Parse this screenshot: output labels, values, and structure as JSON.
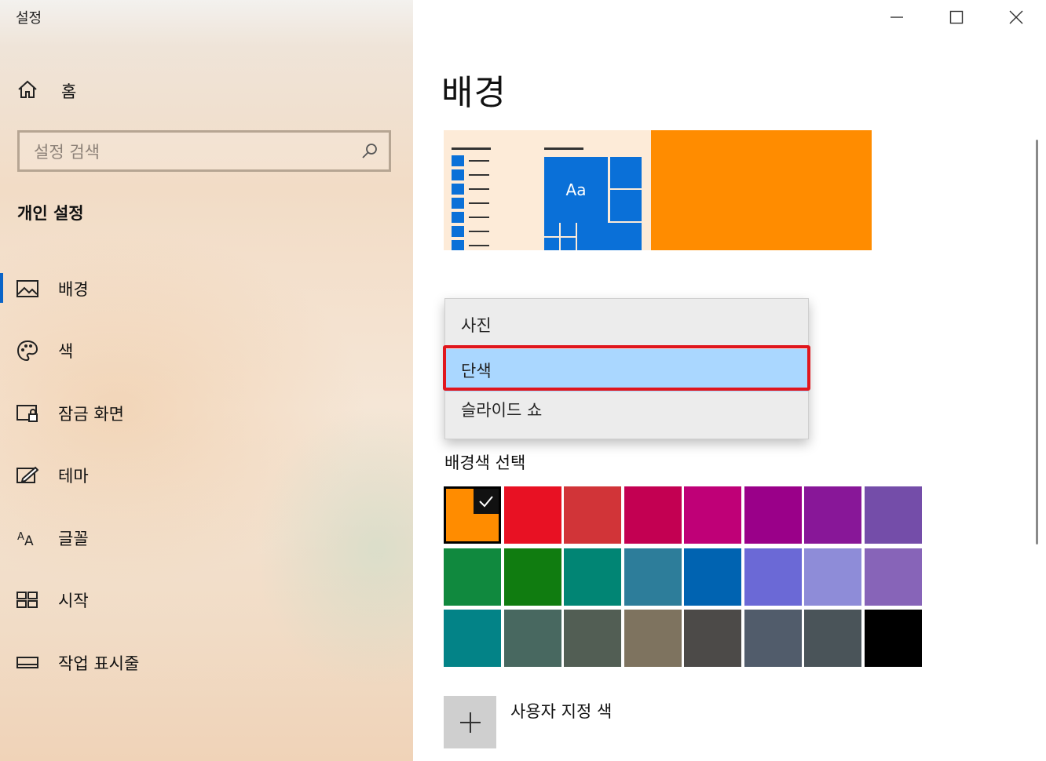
{
  "window": {
    "title": "설정",
    "controls": [
      "minimize-icon",
      "maximize-icon",
      "close-icon"
    ]
  },
  "sidebar": {
    "home_label": "홈",
    "search_placeholder": "설정 검색",
    "section_title": "개인 설정",
    "items": [
      {
        "label": "배경",
        "icon": "picture-icon",
        "active": true
      },
      {
        "label": "색",
        "icon": "palette-icon",
        "active": false
      },
      {
        "label": "잠금 화면",
        "icon": "lock-screen-icon",
        "active": false
      },
      {
        "label": "테마",
        "icon": "theme-icon",
        "active": false
      },
      {
        "label": "글꼴",
        "icon": "font-icon",
        "active": false
      },
      {
        "label": "시작",
        "icon": "start-icon",
        "active": false
      },
      {
        "label": "작업 표시줄",
        "icon": "taskbar-icon",
        "active": false
      }
    ]
  },
  "main": {
    "title": "배경",
    "preview": {
      "tile_text": "Aa",
      "background_color": "#FF8C00"
    },
    "dropdown": {
      "options": [
        "사진",
        "단색",
        "슬라이드 쇼"
      ],
      "selected": "단색"
    },
    "color_section_title": "배경색 선택",
    "colors": [
      "#FF8C00",
      "#E81123",
      "#D13438",
      "#C30052",
      "#BF0077",
      "#9A0089",
      "#881798",
      "#744DA9",
      "#10893E",
      "#107C10",
      "#018574",
      "#2D7D9A",
      "#0063B1",
      "#6B69D6",
      "#8E8CD8",
      "#8764B8",
      "#038387",
      "#486860",
      "#525E54",
      "#7E735F",
      "#4C4A48",
      "#515C6B",
      "#4A5459",
      "#000000"
    ],
    "selected_color_index": 0,
    "custom_color_label": "사용자 지정 색"
  },
  "accent": {
    "highlight_border": "#E0161D",
    "selection_bg": "#AAD7FF",
    "nav_indicator": "#0A64C8"
  }
}
